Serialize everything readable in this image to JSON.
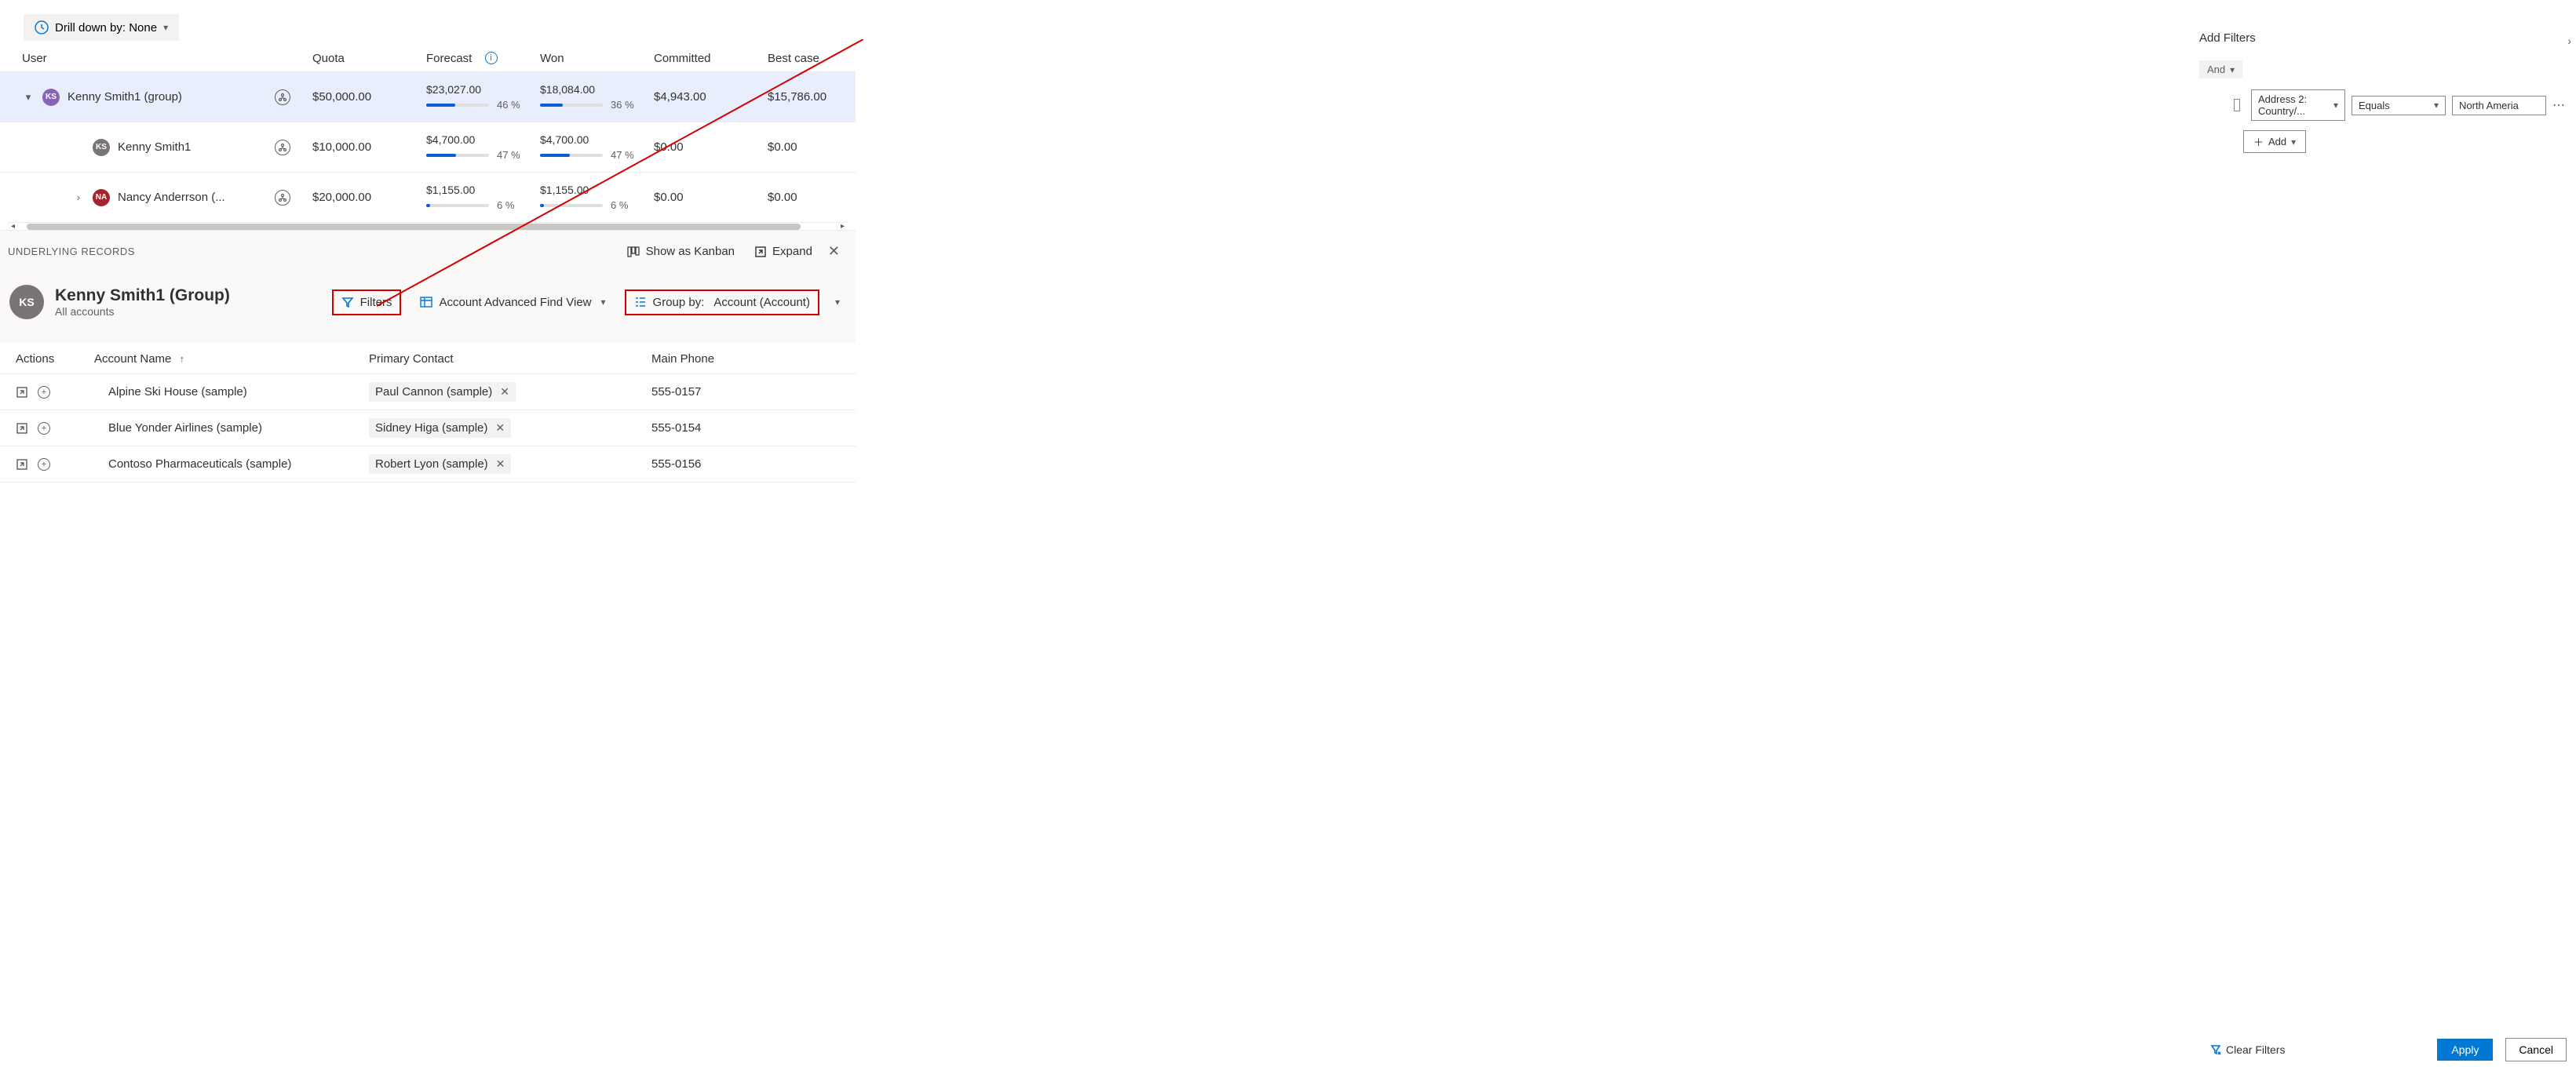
{
  "drilldown": {
    "label": "Drill down by: None"
  },
  "forecast": {
    "headers": {
      "user": "User",
      "quota": "Quota",
      "forecast": "Forecast",
      "won": "Won",
      "committed": "Committed",
      "best": "Best case"
    },
    "rows": [
      {
        "initials": "KS",
        "name": "Kenny Smith1 (group)",
        "quota": "$50,000.00",
        "forecast_amount": "$23,027.00",
        "forecast_pct": "46 %",
        "forecast_fill": 46,
        "won_amount": "$18,084.00",
        "won_pct": "36 %",
        "won_fill": 36,
        "committed": "$4,943.00",
        "best": "$15,786.00"
      },
      {
        "initials": "KS",
        "name": "Kenny Smith1",
        "quota": "$10,000.00",
        "forecast_amount": "$4,700.00",
        "forecast_pct": "47 %",
        "forecast_fill": 47,
        "won_amount": "$4,700.00",
        "won_pct": "47 %",
        "won_fill": 47,
        "committed": "$0.00",
        "best": "$0.00"
      },
      {
        "initials": "NA",
        "name": "Nancy Anderrson (...",
        "quota": "$20,000.00",
        "forecast_amount": "$1,155.00",
        "forecast_pct": "6 %",
        "forecast_fill": 6,
        "won_amount": "$1,155.00",
        "won_pct": "6 %",
        "won_fill": 6,
        "committed": "$0.00",
        "best": "$0.00"
      }
    ]
  },
  "underlying": {
    "section_title": "UNDERLYING RECORDS",
    "kanban_label": "Show as Kanban",
    "expand_label": "Expand",
    "avatar_initials": "KS",
    "name": "Kenny Smith1 (Group)",
    "subtitle": "All accounts",
    "filters_label": "Filters",
    "view_label": "Account Advanced Find View",
    "groupby_label": "Group by:",
    "groupby_value": "Account (Account)"
  },
  "records": {
    "headers": {
      "actions": "Actions",
      "account": "Account Name",
      "contact": "Primary Contact",
      "phone": "Main Phone"
    },
    "rows": [
      {
        "account": "Alpine Ski House (sample)",
        "contact": "Paul Cannon (sample)",
        "phone": "555-0157"
      },
      {
        "account": "Blue Yonder Airlines (sample)",
        "contact": "Sidney Higa (sample)",
        "phone": "555-0154"
      },
      {
        "account": "Contoso Pharmaceuticals (sample)",
        "contact": "Robert Lyon (sample)",
        "phone": "555-0156"
      }
    ]
  },
  "filter_panel": {
    "title": "Add Filters",
    "group_op": "And",
    "condition": {
      "field": "Address 2: Country/...",
      "operator": "Equals",
      "value": "North Ameria"
    },
    "add_label": "Add",
    "clear_label": "Clear Filters",
    "apply_label": "Apply",
    "cancel_label": "Cancel"
  }
}
